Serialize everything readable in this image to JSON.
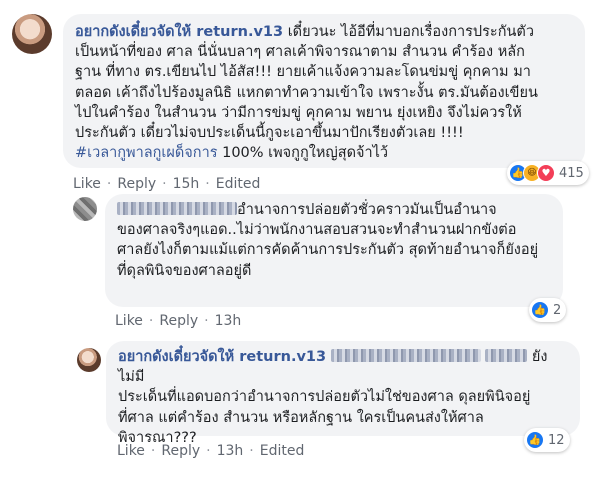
{
  "comment1": {
    "author": "อยากดังเดี๋ยวจัดให้ return.v13",
    "text_lines": [
      " เดี๋ยวนะ ไอ้อีที่มาบอกเรื่องการประกันตัว",
      "เป็นหน้าที่ของ ศาล นี่นั่นบลาๆ ศาลเค้าพิจารณาตาม สำนวน คำร้อง หลัก",
      "ฐาน ที่ทาง ตร.เขียนไป ไอ้สัส!!! ยายเค้าแจ้งความละโดนข่มขู่ คุกคาม มา",
      "ตลอด เค้าถึงไปร้องมูลนิธิ แหกตาทำความเข้าใจ เพราะงั้น ตร.มันต้องเขียน",
      "ไปในคำร้อง ในสำนวน ว่ามีการข่มขู่ คุกคาม พยาน ยุ่งเหยิง จึงไม่ควรให้",
      "ประกันตัว เดี๋ยวไม่จบประเด็นนี้กูจะเอาขึ้นมาปักเรียงตัวเลย !!!!"
    ],
    "hashtag": "#เวลากูพาลกูเผด็จการ",
    "tail": " 100% เพจกูกูใหญ่สุดจ้าไว้",
    "actions": {
      "like": "Like",
      "reply": "Reply",
      "time": "15h",
      "edited": "Edited"
    },
    "reaction_count": "415",
    "reaction_icons": [
      "like-icon",
      "haha-icon",
      "love-icon"
    ]
  },
  "comment2": {
    "text_lines": [
      "อำนาจการปล่อยตัวชั่วคราวมันเป็นอำนาจ",
      "ของศาลจริงๆแอด..ไม่ว่าพนักงานสอบสวนจะทำสำนวนฝากขังต่อ",
      "ศาลยังไงก็ตามแม้แต่การคัดค้านการประกันตัว สุดท้ายอำนาจก็ยังอยู่",
      "ที่ดุลพินิจของศาลอยู่ดี"
    ],
    "actions": {
      "like": "Like",
      "reply": "Reply",
      "time": "13h"
    },
    "reaction_count": "2",
    "reaction_icons": [
      "like-icon"
    ]
  },
  "comment3": {
    "author": "อยากดังเดี๋ยวจัดให้ return.v13",
    "first_tail": "ยังไม่มี",
    "text_lines": [
      "ประเด็นที่แอดบอกว่าอำนาจการปล่อยตัวไม่ใช่ของศาล ดุลยพินิจอยู่",
      "ที่ศาล แต่คำร้อง สำนวน หรือหลักฐาน ใครเป็นคนส่งให้ศาล",
      "พิจารณา???"
    ],
    "actions": {
      "like": "Like",
      "reply": "Reply",
      "time": "13h",
      "edited": "Edited"
    },
    "reaction_count": "12",
    "reaction_icons": [
      "like-icon"
    ]
  }
}
